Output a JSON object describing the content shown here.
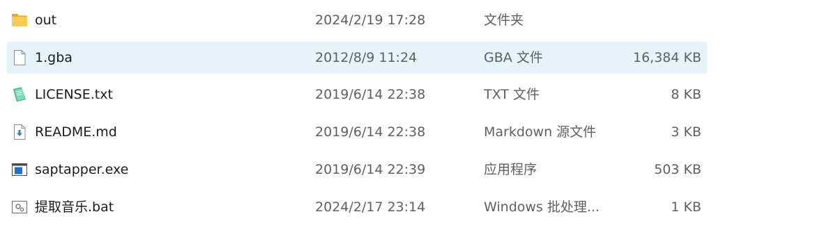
{
  "files": [
    {
      "name": "out",
      "date": "2024/2/19 17:28",
      "type": "文件夹",
      "size": "",
      "icon": "folder-icon",
      "selected": false
    },
    {
      "name": "1.gba",
      "date": "2012/8/9 11:24",
      "type": "GBA 文件",
      "size": "16,384 KB",
      "icon": "generic-file-icon",
      "selected": true
    },
    {
      "name": "LICENSE.txt",
      "date": "2019/6/14 22:38",
      "type": "TXT 文件",
      "size": "8 KB",
      "icon": "notepad-file-icon",
      "selected": false
    },
    {
      "name": "README.md",
      "date": "2019/6/14 22:38",
      "type": "Markdown 源文件",
      "size": "3 KB",
      "icon": "markdown-file-icon",
      "selected": false
    },
    {
      "name": "saptapper.exe",
      "date": "2019/6/14 22:39",
      "type": "应用程序",
      "size": "503 KB",
      "icon": "application-icon",
      "selected": false
    },
    {
      "name": "提取音乐.bat",
      "date": "2024/2/17 23:14",
      "type": "Windows 批处理...",
      "size": "1 KB",
      "icon": "batch-file-icon",
      "selected": false
    }
  ],
  "colors": {
    "selected_row": "#e5f3fb",
    "folder": "#f4c44e",
    "text_primary": "#1b1b1b",
    "text_secondary": "#5f5f5f"
  }
}
